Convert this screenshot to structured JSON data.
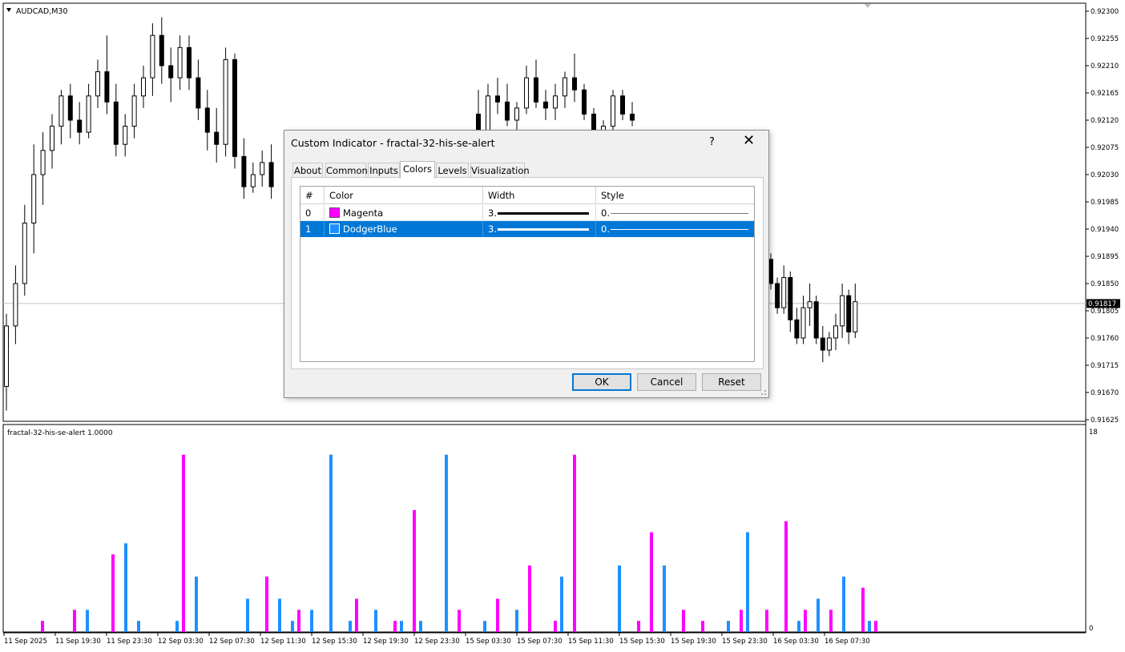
{
  "symbol": "AUDCAD,M30",
  "indicator_label": "fractal-32-his-se-alert 1.0000",
  "current_price": "0.91817",
  "dialog": {
    "title": "Custom Indicator - fractal-32-his-se-alert",
    "help": "?",
    "close": "✕",
    "tabs": [
      "About",
      "Common",
      "Inputs",
      "Colors",
      "Levels",
      "Visualization"
    ],
    "active_tab": "Colors",
    "columns": [
      "#",
      "Color",
      "Width",
      "Style"
    ],
    "rows": [
      {
        "index": "0",
        "color_name": "Magenta",
        "color_hex": "#ff00ff",
        "width": "3.",
        "style": "0.",
        "selected": false
      },
      {
        "index": "1",
        "color_name": "DodgerBlue",
        "color_hex": "#1e90ff",
        "width": "3.",
        "style": "0.",
        "selected": true
      }
    ],
    "buttons": {
      "ok": "OK",
      "cancel": "Cancel",
      "reset": "Reset"
    }
  },
  "chart_data": [
    {
      "type": "candlestick",
      "title": "AUDCAD,M30",
      "y_ticks": [
        "0.92300",
        "0.92255",
        "0.92210",
        "0.92165",
        "0.92120",
        "0.92075",
        "0.92030",
        "0.91985",
        "0.91940",
        "0.91895",
        "0.91850",
        "0.91805",
        "0.91760",
        "0.91715",
        "0.91670",
        "0.91625"
      ],
      "ylim": [
        0.91625,
        0.923
      ],
      "current_price": 0.91817,
      "ohlc": [
        [
          0.9168,
          0.918,
          0.9164,
          0.9178
        ],
        [
          0.9178,
          0.9188,
          0.9175,
          0.9185
        ],
        [
          0.9185,
          0.9198,
          0.9183,
          0.9195
        ],
        [
          0.9195,
          0.9208,
          0.919,
          0.9203
        ],
        [
          0.9203,
          0.921,
          0.9198,
          0.9207
        ],
        [
          0.9207,
          0.9213,
          0.9204,
          0.9211
        ],
        [
          0.9211,
          0.9217,
          0.9208,
          0.9216
        ],
        [
          0.9216,
          0.9218,
          0.9209,
          0.9212
        ],
        [
          0.9212,
          0.9215,
          0.9208,
          0.921
        ],
        [
          0.921,
          0.9218,
          0.9209,
          0.9216
        ],
        [
          0.9216,
          0.9222,
          0.9214,
          0.922
        ],
        [
          0.922,
          0.9226,
          0.9213,
          0.9215
        ],
        [
          0.9215,
          0.9218,
          0.9206,
          0.9208
        ],
        [
          0.9208,
          0.9213,
          0.9206,
          0.9211
        ],
        [
          0.9211,
          0.9218,
          0.9209,
          0.9216
        ],
        [
          0.9216,
          0.9221,
          0.9214,
          0.9219
        ],
        [
          0.9219,
          0.9228,
          0.9216,
          0.9226
        ],
        [
          0.9226,
          0.9229,
          0.9218,
          0.9221
        ],
        [
          0.9221,
          0.9224,
          0.9215,
          0.9219
        ],
        [
          0.9219,
          0.9226,
          0.9217,
          0.9224
        ],
        [
          0.9224,
          0.9226,
          0.9217,
          0.9219
        ],
        [
          0.9219,
          0.9222,
          0.9212,
          0.9214
        ],
        [
          0.9214,
          0.9217,
          0.9207,
          0.921
        ],
        [
          0.921,
          0.9214,
          0.9205,
          0.9208
        ],
        [
          0.9208,
          0.9224,
          0.9206,
          0.9222
        ],
        [
          0.9222,
          0.9223,
          0.9204,
          0.9206
        ],
        [
          0.9206,
          0.9209,
          0.9199,
          0.9201
        ],
        [
          0.9201,
          0.9205,
          0.92,
          0.9203
        ],
        [
          0.9203,
          0.9207,
          0.9201,
          0.9205
        ],
        [
          0.9205,
          0.9208,
          0.9199,
          0.9201
        ]
      ],
      "ohlc_right": [
        [
          0.9213,
          0.9217,
          0.9208,
          0.921
        ],
        [
          0.921,
          0.9218,
          0.9208,
          0.9216
        ],
        [
          0.9216,
          0.9219,
          0.9213,
          0.9215
        ],
        [
          0.9215,
          0.9218,
          0.9211,
          0.9212
        ],
        [
          0.9212,
          0.9215,
          0.921,
          0.9214
        ],
        [
          0.9214,
          0.9221,
          0.9213,
          0.9219
        ],
        [
          0.9219,
          0.9222,
          0.9214,
          0.9215
        ],
        [
          0.9215,
          0.9217,
          0.9212,
          0.9214
        ],
        [
          0.9214,
          0.9218,
          0.9212,
          0.9216
        ],
        [
          0.9216,
          0.922,
          0.9214,
          0.9219
        ],
        [
          0.9219,
          0.9223,
          0.9215,
          0.9217
        ],
        [
          0.9217,
          0.9218,
          0.9212,
          0.9213
        ],
        [
          0.9213,
          0.9214,
          0.9209,
          0.921
        ],
        [
          0.921,
          0.9212,
          0.9208,
          0.9211
        ],
        [
          0.9211,
          0.9217,
          0.921,
          0.9216
        ],
        [
          0.9216,
          0.9217,
          0.9212,
          0.9213
        ],
        [
          0.9213,
          0.9215,
          0.9211,
          0.9212
        ]
      ],
      "ohlc_tail": [
        [
          0.9189,
          0.919,
          0.9184,
          0.9185
        ],
        [
          0.9185,
          0.9186,
          0.918,
          0.9181
        ],
        [
          0.9181,
          0.9188,
          0.918,
          0.9186
        ],
        [
          0.9186,
          0.9187,
          0.9177,
          0.9179
        ],
        [
          0.9179,
          0.9181,
          0.9175,
          0.9176
        ],
        [
          0.9176,
          0.9183,
          0.9175,
          0.9181
        ],
        [
          0.9181,
          0.9185,
          0.9178,
          0.9182
        ],
        [
          0.9182,
          0.9183,
          0.9175,
          0.9176
        ],
        [
          0.9176,
          0.9178,
          0.9172,
          0.9174
        ],
        [
          0.9174,
          0.9177,
          0.9173,
          0.9176
        ],
        [
          0.9176,
          0.918,
          0.9174,
          0.9178
        ],
        [
          0.9178,
          0.9185,
          0.9176,
          0.9183
        ],
        [
          0.9183,
          0.9184,
          0.9175,
          0.9177
        ],
        [
          0.9177,
          0.9185,
          0.9176,
          0.9182
        ]
      ]
    },
    {
      "type": "bar",
      "title": "fractal-32-his-se-alert 1.0000",
      "ylim": [
        0,
        18
      ],
      "y_ticks": [
        "18",
        "0"
      ],
      "x_ticks": [
        "11 Sep 2025",
        "11 Sep 19:30",
        "11 Sep 23:30",
        "12 Sep 03:30",
        "12 Sep 07:30",
        "12 Sep 11:30",
        "12 Sep 15:30",
        "12 Sep 19:30",
        "12 Sep 23:30",
        "15 Sep 03:30",
        "15 Sep 07:30",
        "15 Sep 11:30",
        "15 Sep 15:30",
        "15 Sep 19:30",
        "15 Sep 23:30",
        "16 Sep 03:30",
        "16 Sep 07:30"
      ],
      "colors": {
        "Magenta": "#ff00ff",
        "DodgerBlue": "#1e90ff"
      },
      "bars": [
        {
          "slot": 3,
          "color": "Magenta",
          "value": 1
        },
        {
          "slot": 8,
          "color": "Magenta",
          "value": 2
        },
        {
          "slot": 10,
          "color": "DodgerBlue",
          "value": 2
        },
        {
          "slot": 14,
          "color": "Magenta",
          "value": 7
        },
        {
          "slot": 16,
          "color": "DodgerBlue",
          "value": 8
        },
        {
          "slot": 18,
          "color": "DodgerBlue",
          "value": 1
        },
        {
          "slot": 24,
          "color": "DodgerBlue",
          "value": 1
        },
        {
          "slot": 25,
          "color": "Magenta",
          "value": 16
        },
        {
          "slot": 27,
          "color": "DodgerBlue",
          "value": 5
        },
        {
          "slot": 35,
          "color": "DodgerBlue",
          "value": 3
        },
        {
          "slot": 38,
          "color": "Magenta",
          "value": 5
        },
        {
          "slot": 40,
          "color": "DodgerBlue",
          "value": 3
        },
        {
          "slot": 42,
          "color": "DodgerBlue",
          "value": 1
        },
        {
          "slot": 43,
          "color": "Magenta",
          "value": 2
        },
        {
          "slot": 45,
          "color": "DodgerBlue",
          "value": 2
        },
        {
          "slot": 48,
          "color": "DodgerBlue",
          "value": 16
        },
        {
          "slot": 51,
          "color": "DodgerBlue",
          "value": 1
        },
        {
          "slot": 52,
          "color": "Magenta",
          "value": 3
        },
        {
          "slot": 55,
          "color": "DodgerBlue",
          "value": 2
        },
        {
          "slot": 58,
          "color": "Magenta",
          "value": 1
        },
        {
          "slot": 59,
          "color": "DodgerBlue",
          "value": 1
        },
        {
          "slot": 61,
          "color": "Magenta",
          "value": 11
        },
        {
          "slot": 62,
          "color": "DodgerBlue",
          "value": 1
        },
        {
          "slot": 66,
          "color": "DodgerBlue",
          "value": 16
        },
        {
          "slot": 68,
          "color": "Magenta",
          "value": 2
        },
        {
          "slot": 72,
          "color": "DodgerBlue",
          "value": 1
        },
        {
          "slot": 74,
          "color": "Magenta",
          "value": 3
        },
        {
          "slot": 77,
          "color": "DodgerBlue",
          "value": 2
        },
        {
          "slot": 79,
          "color": "Magenta",
          "value": 6
        },
        {
          "slot": 83,
          "color": "Magenta",
          "value": 1
        },
        {
          "slot": 84,
          "color": "DodgerBlue",
          "value": 5
        },
        {
          "slot": 86,
          "color": "Magenta",
          "value": 16
        },
        {
          "slot": 93,
          "color": "DodgerBlue",
          "value": 6
        },
        {
          "slot": 96,
          "color": "Magenta",
          "value": 1
        },
        {
          "slot": 98,
          "color": "Magenta",
          "value": 9
        },
        {
          "slot": 100,
          "color": "DodgerBlue",
          "value": 6
        },
        {
          "slot": 103,
          "color": "Magenta",
          "value": 2
        },
        {
          "slot": 106,
          "color": "Magenta",
          "value": 1
        },
        {
          "slot": 110,
          "color": "DodgerBlue",
          "value": 1
        },
        {
          "slot": 112,
          "color": "Magenta",
          "value": 2
        },
        {
          "slot": 113,
          "color": "DodgerBlue",
          "value": 9
        },
        {
          "slot": 116,
          "color": "Magenta",
          "value": 2
        },
        {
          "slot": 119,
          "color": "Magenta",
          "value": 10
        },
        {
          "slot": 121,
          "color": "DodgerBlue",
          "value": 1
        },
        {
          "slot": 122,
          "color": "Magenta",
          "value": 2
        },
        {
          "slot": 124,
          "color": "DodgerBlue",
          "value": 3
        },
        {
          "slot": 126,
          "color": "Magenta",
          "value": 2
        },
        {
          "slot": 128,
          "color": "DodgerBlue",
          "value": 5
        },
        {
          "slot": 131,
          "color": "Magenta",
          "value": 4
        },
        {
          "slot": 132,
          "color": "DodgerBlue",
          "value": 1
        },
        {
          "slot": 133,
          "color": "Magenta",
          "value": 1
        }
      ]
    }
  ]
}
